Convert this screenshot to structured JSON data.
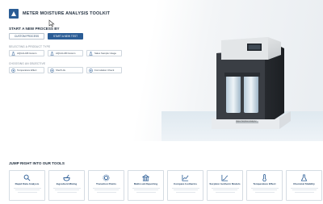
{
  "app": {
    "title": "METER MOISTURE ANALYSIS TOOLKIT"
  },
  "start": {
    "title": "START A NEW PROCESS BY",
    "primary_buttons": [
      {
        "label": "CUSTOM PROCESS"
      },
      {
        "label": "START A NEW TEST"
      }
    ]
  },
  "row1": {
    "label": "SELECTING A PRODUCT TYPE",
    "chips": [
      {
        "label": "AQUALAB Custom",
        "icon": "flask-icon"
      },
      {
        "label": "AQUALAB Custom",
        "icon": "flask-icon"
      },
      {
        "label": "Sales Sample Usage",
        "icon": "flask-icon"
      }
    ]
  },
  "row2": {
    "label": "CHOOSING AN OBJECTIVE",
    "chips": [
      {
        "label": "Temperature Effect",
        "icon": "target-icon"
      },
      {
        "label": "Shelf Life",
        "icon": "target-icon"
      },
      {
        "label": "Formulation Check",
        "icon": "target-icon"
      }
    ]
  },
  "device": {
    "label": "Vapor Sorption Analyzer"
  },
  "tools": {
    "title": "JUMP RIGHT INTO OUR TOOLS",
    "items": [
      {
        "title": "Rapid Data Analysis",
        "icon": "magnifier-icon"
      },
      {
        "title": "Ingredient Mixing",
        "icon": "bowl-icon"
      },
      {
        "title": "Transition Points",
        "icon": "gear-icon"
      },
      {
        "title": "Multi-Lab Reporting",
        "icon": "building-icon"
      },
      {
        "title": "Compare Isotherms",
        "icon": "line-chart-icon"
      },
      {
        "title": "Sorption Isotherm Models",
        "icon": "curve-chart-icon"
      },
      {
        "title": "Temperature Effect",
        "icon": "thermometer-icon"
      },
      {
        "title": "Chemical Stability",
        "icon": "flask-icon"
      }
    ]
  },
  "colors": {
    "primary": "#2b5d96",
    "text": "#1f2d3d",
    "muted": "#7b8794",
    "border": "#d5dce3"
  }
}
